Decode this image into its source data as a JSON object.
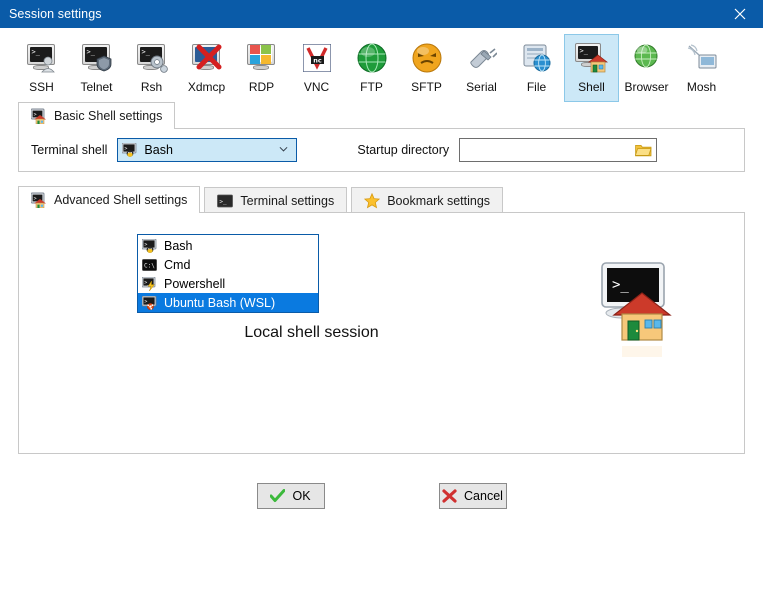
{
  "window": {
    "title": "Session settings",
    "titlebar_color": "#0a5ba8",
    "close_icon": "close-icon"
  },
  "toolbar": {
    "selected": "Shell",
    "selected_bg": "#cce8f7",
    "items": [
      {
        "label": "SSH",
        "icon": "ssh-icon"
      },
      {
        "label": "Telnet",
        "icon": "telnet-icon"
      },
      {
        "label": "Rsh",
        "icon": "rsh-icon"
      },
      {
        "label": "Xdmcp",
        "icon": "xdmcp-icon"
      },
      {
        "label": "RDP",
        "icon": "rdp-icon"
      },
      {
        "label": "VNC",
        "icon": "vnc-icon"
      },
      {
        "label": "FTP",
        "icon": "ftp-icon"
      },
      {
        "label": "SFTP",
        "icon": "sftp-icon"
      },
      {
        "label": "Serial",
        "icon": "serial-icon"
      },
      {
        "label": "File",
        "icon": "file-icon"
      },
      {
        "label": "Shell",
        "icon": "shell-icon"
      },
      {
        "label": "Browser",
        "icon": "browser-icon"
      },
      {
        "label": "Mosh",
        "icon": "mosh-icon"
      }
    ]
  },
  "basic_tab": {
    "label": "Basic Shell settings",
    "icon": "shell-icon",
    "terminal_shell": {
      "label": "Terminal shell",
      "value": "Bash",
      "icon": "bash-icon",
      "expanded": true,
      "highlight_color": "#0a7ae0",
      "options": [
        {
          "label": "Bash",
          "icon": "bash-icon",
          "selected": false
        },
        {
          "label": "Cmd",
          "icon": "cmd-icon",
          "selected": false
        },
        {
          "label": "Powershell",
          "icon": "powershell-icon",
          "selected": false
        },
        {
          "label": "Ubuntu Bash (WSL)",
          "icon": "ubuntu-icon",
          "selected": true
        }
      ]
    },
    "startup_directory": {
      "label": "Startup directory",
      "value": "",
      "placeholder": "",
      "browse_icon": "folder-open-icon"
    }
  },
  "sub_tabs": [
    {
      "label": "Advanced Shell settings",
      "icon": "shell-icon",
      "active": true
    },
    {
      "label": "Terminal settings",
      "icon": "terminal-icon",
      "active": false
    },
    {
      "label": "Bookmark settings",
      "icon": "star-icon",
      "active": false
    }
  ],
  "content": {
    "message": "Local shell session",
    "illustration": "local-shell-icon"
  },
  "footer": {
    "ok": {
      "label": "OK",
      "icon": "check-icon",
      "color": "#3cb93c"
    },
    "cancel": {
      "label": "Cancel",
      "icon": "cross-icon",
      "color": "#d03030"
    }
  }
}
